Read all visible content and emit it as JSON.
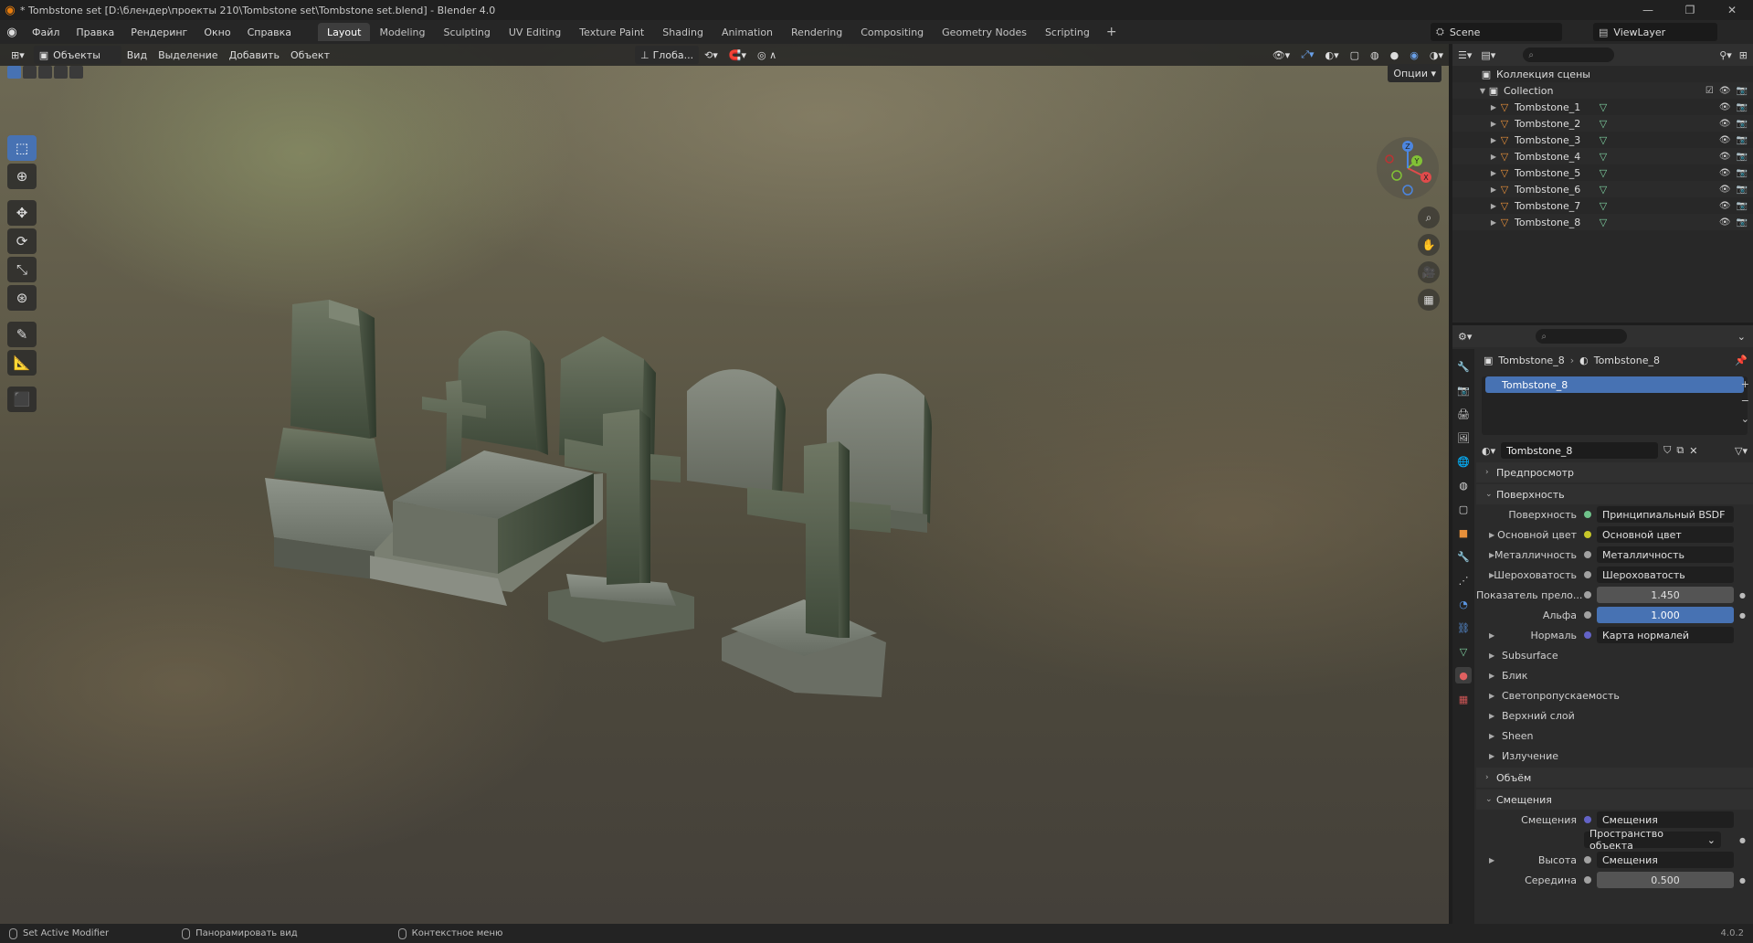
{
  "titlebar": {
    "title": "* Tombstone set [D:\\блендер\\проекты 210\\Tombstone set\\Tombstone set.blend] - Blender 4.0"
  },
  "menu": {
    "items": [
      "Файл",
      "Правка",
      "Рендеринг",
      "Окно",
      "Справка"
    ]
  },
  "workspaces": {
    "tabs": [
      "Layout",
      "Modeling",
      "Sculpting",
      "UV Editing",
      "Texture Paint",
      "Shading",
      "Animation",
      "Rendering",
      "Compositing",
      "Geometry Nodes",
      "Scripting"
    ],
    "active": "Layout",
    "add": "+"
  },
  "scene": {
    "name": "Scene",
    "view_layer": "ViewLayer"
  },
  "viewport": {
    "mode": "Объекты",
    "menus": [
      "Вид",
      "Выделение",
      "Добавить",
      "Объект"
    ],
    "orientation": "Глоба...",
    "options": "Опции"
  },
  "gizmo": {
    "x": "X",
    "y": "Y",
    "z": "Z"
  },
  "outliner": {
    "scene_collection": "Коллекция сцены",
    "collection": "Collection",
    "objects": [
      "Tombstone_1",
      "Tombstone_2",
      "Tombstone_3",
      "Tombstone_4",
      "Tombstone_5",
      "Tombstone_6",
      "Tombstone_7",
      "Tombstone_8"
    ]
  },
  "properties": {
    "breadcrumb_object": "Tombstone_8",
    "breadcrumb_material": "Tombstone_8",
    "slot": "Tombstone_8",
    "material_name": "Tombstone_8",
    "sections": {
      "preview": "Предпросмотр",
      "surface": "Поверхность",
      "volume": "Объём",
      "displacement": "Смещения"
    },
    "surface_rows": [
      {
        "label": "Поверхность",
        "value": "Принципиальный BSDF",
        "socket": "#6fc28a",
        "expand": false,
        "kind": "dark"
      },
      {
        "label": "Основной цвет",
        "value": "Основной цвет",
        "socket": "#c7c729",
        "expand": true,
        "kind": "dark"
      },
      {
        "label": "Металличность",
        "value": "Металличность",
        "socket": "#a1a1a1",
        "expand": true,
        "kind": "dark"
      },
      {
        "label": "Шероховатость",
        "value": "Шероховатость",
        "socket": "#a1a1a1",
        "expand": true,
        "kind": "dark"
      },
      {
        "label": "Показатель прело...",
        "value": "1.450",
        "socket": "#a1a1a1",
        "expand": false,
        "kind": "num"
      },
      {
        "label": "Альфа",
        "value": "1.000",
        "socket": "#a1a1a1",
        "expand": false,
        "kind": "blue"
      },
      {
        "label": "Нормаль",
        "value": "Карта нормалей",
        "socket": "#6363c7",
        "expand": true,
        "kind": "dark"
      }
    ],
    "subpanels": [
      "Subsurface",
      "Блик",
      "Светопропускаемость",
      "Верхний слой",
      "Sheen",
      "Излучение"
    ],
    "displacement_rows": [
      {
        "label": "Смещения",
        "value": "Смещения",
        "socket": "#6363c7",
        "expand": false,
        "kind": "dark"
      },
      {
        "label": "",
        "value": "Пространство объекта",
        "socket": "",
        "expand": false,
        "kind": "select"
      },
      {
        "label": "Высота",
        "value": "Смещения",
        "socket": "#a1a1a1",
        "expand": true,
        "kind": "dark"
      },
      {
        "label": "Середина",
        "value": "0.500",
        "socket": "#a1a1a1",
        "expand": false,
        "kind": "num"
      }
    ]
  },
  "statusbar": {
    "left": "Set Active Modifier",
    "middle": "Панорамировать вид",
    "right": "Контекстное меню",
    "version": "4.0.2"
  }
}
